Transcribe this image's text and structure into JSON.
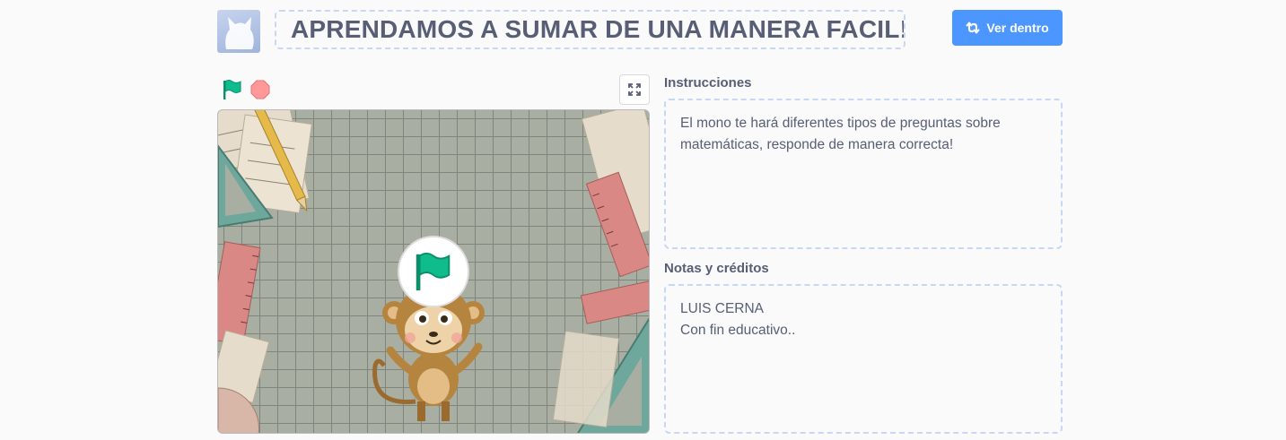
{
  "project": {
    "title": "APRENDAMOS A SUMAR DE UNA MANERA FACIL!",
    "see_inside_label": "Ver dentro",
    "see_inside_icon": "remix-icon"
  },
  "player": {
    "green_flag_icon": "green-flag-icon",
    "stop_icon": "stop-icon",
    "fullscreen_icon": "fullscreen-icon",
    "play_overlay_icon": "green-flag-icon",
    "flag_color": "#0fbd8c",
    "stop_color": "#ff9999"
  },
  "instructions": {
    "label": "Instrucciones",
    "text": "El mono te hará diferentes tipos de preguntas sobre matemáticas, responde de manera correcta!"
  },
  "notes": {
    "label": "Notas y créditos",
    "text": "LUIS CERNA\nCon fin educativo.."
  },
  "colors": {
    "accent": "#4c97ff",
    "text": "#575e75",
    "dashed_border": "#c6d7f7"
  }
}
